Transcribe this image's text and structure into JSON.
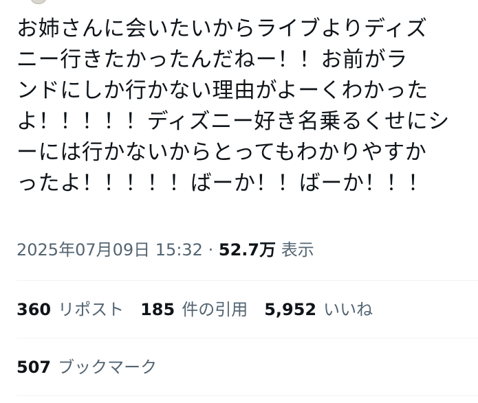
{
  "tweet": {
    "lines": [
      "お姉さんに会いたいからライブよりディズ",
      "ニー行きたかったんだねー！！お前がラ",
      "ンドにしか行かない理由がよーくわかった",
      "よ！！！！！ディズニー好き名乗るくせにシ",
      "ーには行かないからとってもわかりやすか",
      "ったよ！！！！！ばーか！！ばーか！！！"
    ],
    "timestamp": "2025年07月09日 15:32",
    "separator": "·",
    "views_count": "52.7万",
    "views_label": "表示"
  },
  "stats": {
    "reposts_count": "360",
    "reposts_label": "リポスト",
    "quotes_count": "185",
    "quotes_label": "件の引用",
    "likes_count": "5,952",
    "likes_label": "いいね",
    "bookmarks_count": "507",
    "bookmarks_label": "ブックマーク"
  },
  "colors": {
    "text": "#0f1419",
    "secondary": "#536471",
    "divider": "#eff3f4",
    "background": "#ffffff"
  }
}
